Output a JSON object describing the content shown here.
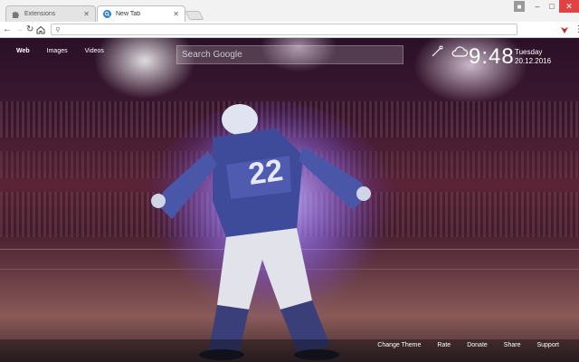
{
  "tabs": [
    {
      "label": "Extensions",
      "favicon": "puzzle-icon",
      "active": false
    },
    {
      "label": "New Tab",
      "favicon": "search-logo-icon",
      "active": true
    }
  ],
  "toolbar": {
    "address_value": "",
    "icons": [
      "back-icon",
      "forward-icon",
      "reload-icon",
      "home-icon",
      "search-icon",
      "extension-icon",
      "menu-icon"
    ]
  },
  "ntp": {
    "search_tabs": [
      "Web",
      "Images",
      "Videos"
    ],
    "search_placeholder": "Search Google",
    "time": "9:48",
    "day": "Tuesday",
    "date": "20.12.2016",
    "weather_icon": "cloud-icon",
    "settings_icon": "brush-icon",
    "jersey_number": "22",
    "footer_links": [
      "Change Theme",
      "Rate",
      "Donate",
      "Share",
      "Support"
    ]
  },
  "colors": {
    "window_close": "#e04343",
    "page_text": "#ffffff",
    "chrome_bg": "#f2f2f2"
  }
}
